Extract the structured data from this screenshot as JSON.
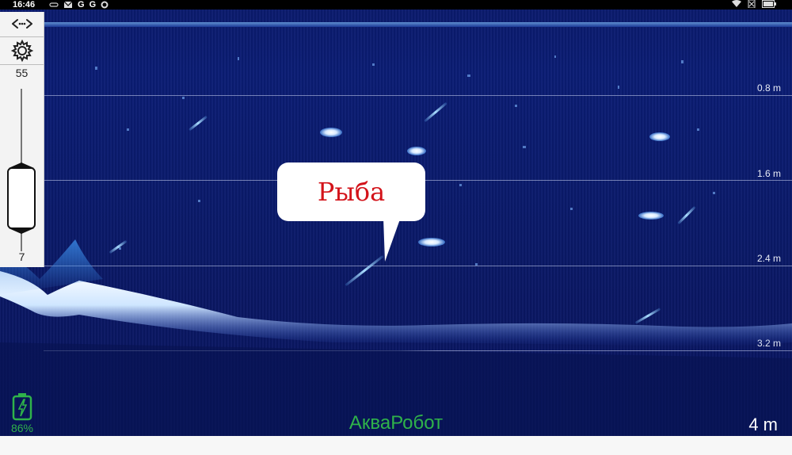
{
  "status_bar": {
    "time": "16:46",
    "notification_letters": [
      "G",
      "G"
    ]
  },
  "sonar": {
    "depth_labels": [
      "0.8 m",
      "1.6 m",
      "2.4 m",
      "3.2 m"
    ],
    "callout_text": "Рыба",
    "range_label": "4 m",
    "brand": "АкваРобот"
  },
  "left_panel": {
    "slider_max": "55",
    "slider_min": "7"
  },
  "battery": {
    "percent": "86%",
    "color": "#2fb24a"
  },
  "colors": {
    "water": "#0b1b6e",
    "bottom_echo": "#ffffff",
    "callout_text": "#d3131a"
  },
  "icons": {
    "toggle": "horizontal-arrows-icon",
    "settings": "gear-icon",
    "battery": "battery-charging-icon"
  }
}
